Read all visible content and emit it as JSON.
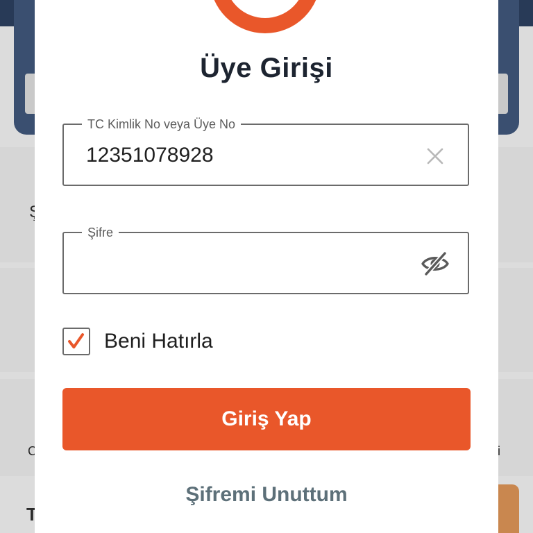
{
  "modal": {
    "title": "Üye Girişi"
  },
  "fields": {
    "id_label": "TC Kimlik No veya Üye No",
    "id_value": "12351078928",
    "password_label": "Şifre",
    "password_value": ""
  },
  "remember": {
    "label": "Beni Hatırla",
    "checked": true
  },
  "actions": {
    "login_label": "Giriş Yap",
    "forgot_label": "Şifremi Unuttum"
  },
  "icons": {
    "clear": "close-icon",
    "toggle_password": "eye-off-icon",
    "check": "checkmark-icon"
  },
  "colors": {
    "accent": "#e9572a",
    "link": "#5d7079",
    "text": "#1d2430"
  },
  "background": {
    "partial_text_1": "Ş",
    "partial_text_2": "C",
    "partial_text_3": "T",
    "partial_text_4": "zi"
  }
}
